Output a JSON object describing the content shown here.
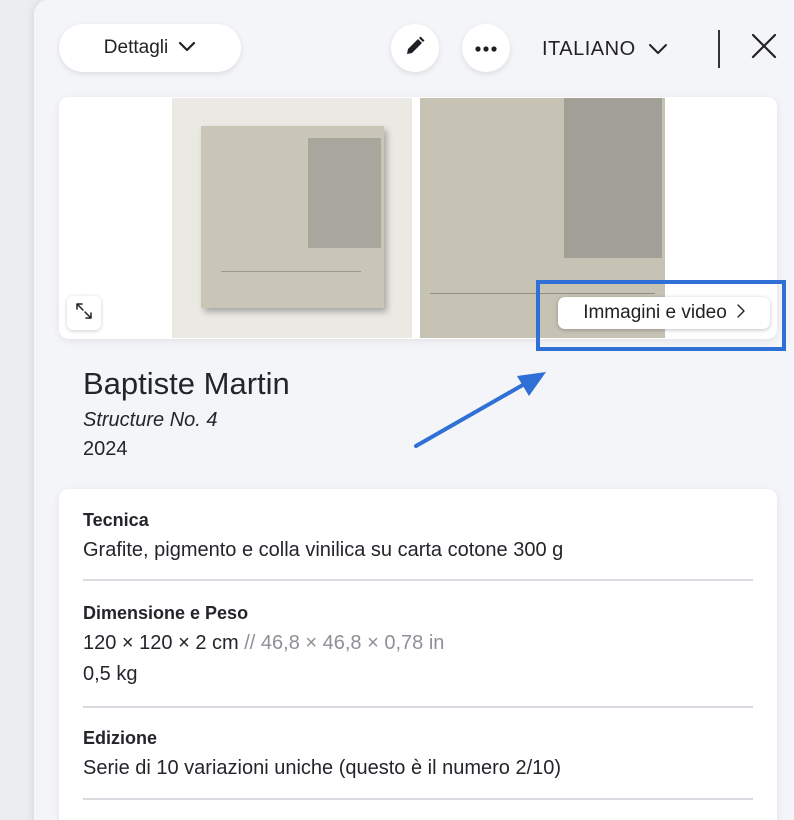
{
  "toolbar": {
    "details_label": "Dettagli",
    "language_label": "ITALIANO"
  },
  "icons": {
    "chevron": "chevron-down-icon",
    "edit": "pencil-icon",
    "more": "more-horizontal-icon",
    "close": "close-icon",
    "expand": "expand-icon",
    "next": "chevron-right-icon"
  },
  "media": {
    "button_label": "Immagini e video"
  },
  "artwork": {
    "artist": "Baptiste Martin",
    "title": "Structure No. 4",
    "year": "2024"
  },
  "details": {
    "technique_label": "Tecnica",
    "technique_value": "Grafite, pigmento e colla vinilica su carta cotone 300 g",
    "dimensions_label": "Dimensione e Peso",
    "dimensions_cm": "120 × 120 × 2 cm",
    "dimensions_in": "// 46,8 × 46,8 × 0,78 in",
    "weight": "0,5 kg",
    "edition_label": "Edizione",
    "edition_value": "Serie di 10 variazioni uniche (questo è il numero 2/10)"
  },
  "colors": {
    "highlight": "#2f6fd6",
    "panel": "#f4f5f8"
  }
}
